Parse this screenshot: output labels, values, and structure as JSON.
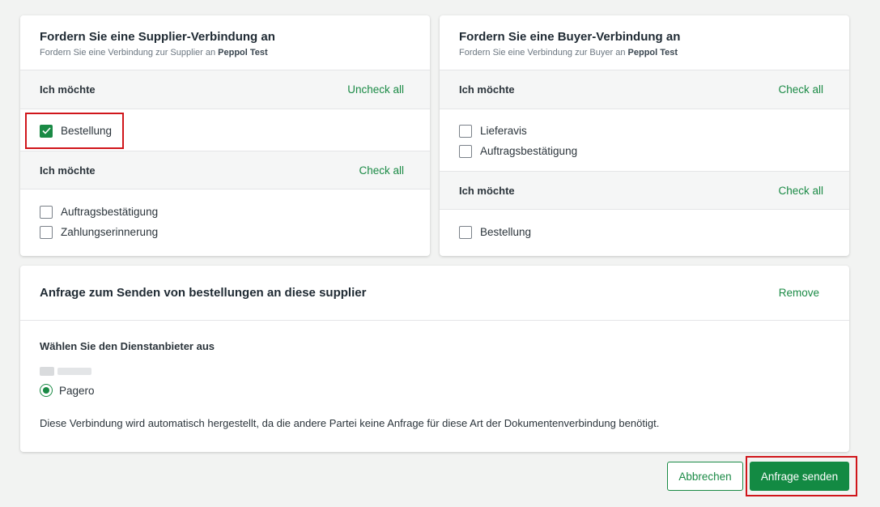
{
  "supplier_card": {
    "title": "Fordern Sie eine Supplier-Verbindung an",
    "subtitle_prefix": "Fordern Sie eine Verbindung zur Supplier an",
    "subtitle_company": "Peppol Test",
    "sections": [
      {
        "label": "Ich möchte",
        "action": "Uncheck all",
        "items": [
          {
            "label": "Bestellung",
            "checked": true
          }
        ]
      },
      {
        "label": "Ich möchte",
        "action": "Check all",
        "items": [
          {
            "label": "Auftragsbestätigung",
            "checked": false
          },
          {
            "label": "Zahlungserinnerung",
            "checked": false
          }
        ]
      }
    ]
  },
  "buyer_card": {
    "title": "Fordern Sie eine Buyer-Verbindung an",
    "subtitle_prefix": "Fordern Sie eine Verbindung zur Buyer an",
    "subtitle_company": "Peppol Test",
    "sections": [
      {
        "label": "Ich möchte",
        "action": "Check all",
        "items": [
          {
            "label": "Lieferavis",
            "checked": false
          },
          {
            "label": "Auftragsbestätigung",
            "checked": false
          }
        ]
      },
      {
        "label": "Ich möchte",
        "action": "Check all",
        "items": [
          {
            "label": "Bestellung",
            "checked": false
          }
        ]
      }
    ]
  },
  "request_card": {
    "title": "Anfrage zum Senden von bestellungen an diese supplier",
    "remove_label": "Remove",
    "provider_heading": "Wählen Sie den Dienstanbieter aus",
    "provider_option": "Pagero",
    "note": "Diese Verbindung wird automatisch hergestellt, da die andere Partei keine Anfrage für diese Art der Dokumentenverbindung benötigt."
  },
  "footer": {
    "cancel_label": "Abbrechen",
    "submit_label": "Anfrage senden"
  },
  "colors": {
    "accent": "#1a8a45",
    "highlight": "#d0161b"
  }
}
